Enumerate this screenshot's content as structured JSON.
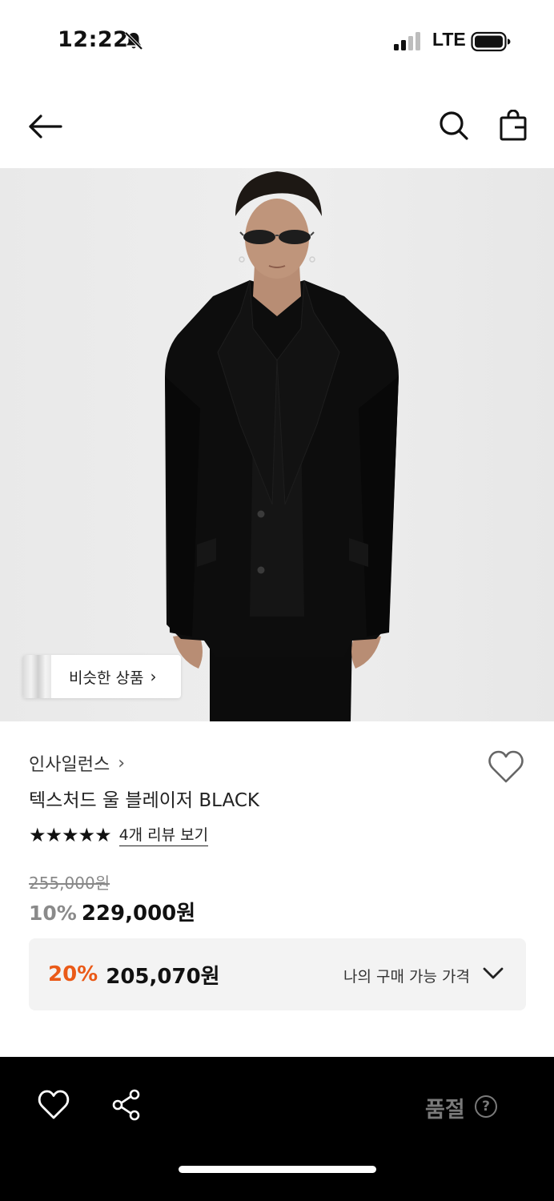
{
  "status_bar": {
    "time": "12:22",
    "network": "LTE",
    "icons": [
      "bell-slash-icon",
      "signal-icon",
      "battery-icon"
    ]
  },
  "nav": {
    "icons": [
      "back-arrow-icon",
      "search-icon",
      "shopping-bag-icon"
    ]
  },
  "image": {
    "similar_button_label": "비슷한 상품",
    "similar_button_chevron": "›"
  },
  "product": {
    "brand": "인사일런스",
    "brand_chevron": "›",
    "title": "텍스처드 울 블레이저 BLACK",
    "rating": 5,
    "rating_stars": "★★★★★",
    "review_link": "4개 리뷰 보기",
    "original_price": "255,000원",
    "discount_rate": "10%",
    "sale_price": "229,000원",
    "my_price": {
      "discount_rate": "20%",
      "price": "205,070원",
      "label": "나의 구매 가능 가격"
    }
  },
  "bottom_bar": {
    "soldout_label": "품절",
    "help_label": "?"
  },
  "colors": {
    "accent_orange": "#ea5a18",
    "bottom_bar": "#000000",
    "image_background": "#ebebeb",
    "price_box": "#f3f3f3"
  }
}
